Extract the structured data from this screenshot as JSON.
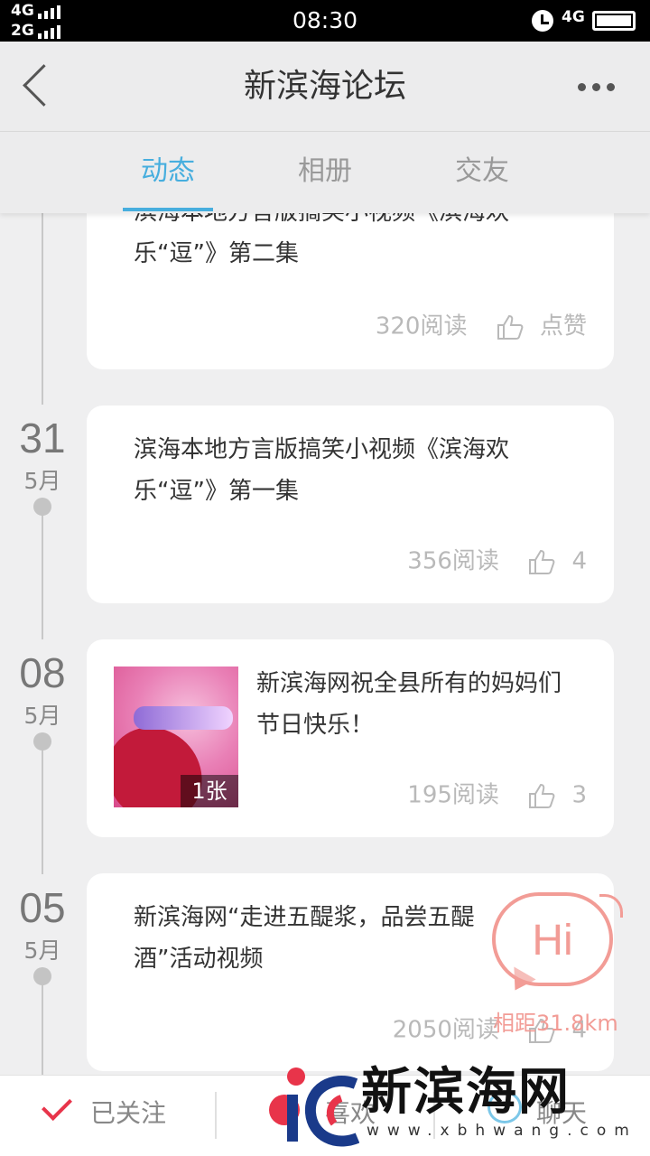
{
  "status_bar": {
    "signal_1": "4G",
    "signal_2": "2G",
    "time": "08:30",
    "network": "4G"
  },
  "header": {
    "title": "新滨海论坛"
  },
  "tabs": [
    {
      "label": "动态",
      "active": true
    },
    {
      "label": "相册",
      "active": false
    },
    {
      "label": "交友",
      "active": false
    }
  ],
  "feed": [
    {
      "day": "",
      "month": "",
      "text": "滨海本地方言版搞笑小视频《滨海欢乐“逗”》第二集",
      "text_line1": "滨海本地方言版搞笑小视频《滨海欢",
      "text_line2": "乐“逗”》第二集",
      "reads": "320阅读",
      "likes": "点赞"
    },
    {
      "day": "31",
      "month": "5月",
      "text_line1": "滨海本地方言版搞笑小视频《滨海欢",
      "text_line2": "乐“逗”》第一集",
      "reads": "356阅读",
      "likes": "4"
    },
    {
      "day": "08",
      "month": "5月",
      "text_line1": "新滨海网祝全县所有的妈妈们",
      "text_line2": "节日快乐！",
      "image_count": "1张",
      "reads": "195阅读",
      "likes": "3"
    },
    {
      "day": "05",
      "month": "5月",
      "text_line1": "新滨海网“走进五醍浆，品尝五醍",
      "text_line2": "酒”活动视频",
      "reads": "2050阅读",
      "likes": "4"
    }
  ],
  "hi_bubble": {
    "label": "Hi",
    "distance": "相距31.8km"
  },
  "bottom_bar": {
    "follow_label": "已关注",
    "like_label": "喜欢",
    "chat_label": "聊天"
  },
  "watermark": {
    "name": "新滨海网",
    "url": "www.xbhwang.com"
  },
  "colors": {
    "accent": "#47aede",
    "follow_check": "#e8344a",
    "hi": "#f29c96"
  }
}
